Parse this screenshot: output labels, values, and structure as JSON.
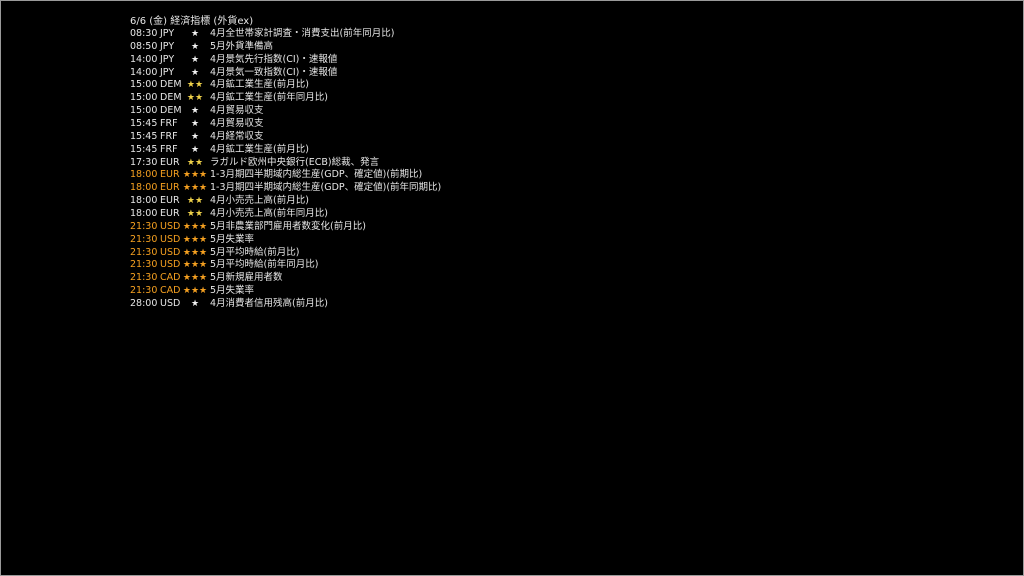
{
  "header": "6/6 (金) 経済指標 (外貨ex)",
  "colors": {
    "background": "#000000",
    "text": "#e6e6e6",
    "highlight": "#f5a020",
    "mid_stars": "#f0d24a"
  },
  "rows": [
    {
      "time": "08:30",
      "currency": "JPY",
      "stars": "★",
      "event": "4月全世帯家計調査・消費支出(前年同月比)",
      "level": 1
    },
    {
      "time": "08:50",
      "currency": "JPY",
      "stars": "★",
      "event": "5月外貨準備高",
      "level": 1
    },
    {
      "time": "14:00",
      "currency": "JPY",
      "stars": "★",
      "event": "4月景気先行指数(CI)・速報値",
      "level": 1
    },
    {
      "time": "14:00",
      "currency": "JPY",
      "stars": "★",
      "event": "4月景気一致指数(CI)・速報値",
      "level": 1
    },
    {
      "time": "15:00",
      "currency": "DEM",
      "stars": "★★",
      "event": "4月鉱工業生産(前月比)",
      "level": 2
    },
    {
      "time": "15:00",
      "currency": "DEM",
      "stars": "★★",
      "event": "4月鉱工業生産(前年同月比)",
      "level": 2
    },
    {
      "time": "15:00",
      "currency": "DEM",
      "stars": "★",
      "event": "4月貿易収支",
      "level": 1
    },
    {
      "time": "15:45",
      "currency": "FRF",
      "stars": "★",
      "event": "4月貿易収支",
      "level": 1
    },
    {
      "time": "15:45",
      "currency": "FRF",
      "stars": "★",
      "event": "4月経常収支",
      "level": 1
    },
    {
      "time": "15:45",
      "currency": "FRF",
      "stars": "★",
      "event": "4月鉱工業生産(前月比)",
      "level": 1
    },
    {
      "time": "17:30",
      "currency": "EUR",
      "stars": "★★",
      "event": "ラガルド欧州中央銀行(ECB)総裁、発言",
      "level": 2
    },
    {
      "time": "18:00",
      "currency": "EUR",
      "stars": "★★★",
      "event": "1-3月期四半期域内総生産(GDP、確定値)(前期比)",
      "level": 3
    },
    {
      "time": "18:00",
      "currency": "EUR",
      "stars": "★★★",
      "event": "1-3月期四半期域内総生産(GDP、確定値)(前年同期比)",
      "level": 3
    },
    {
      "time": "18:00",
      "currency": "EUR",
      "stars": "★★",
      "event": "4月小売売上高(前月比)",
      "level": 2
    },
    {
      "time": "18:00",
      "currency": "EUR",
      "stars": "★★",
      "event": "4月小売売上高(前年同月比)",
      "level": 2
    },
    {
      "time": "21:30",
      "currency": "USD",
      "stars": "★★★",
      "event": "5月非農業部門雇用者数変化(前月比)",
      "level": 3
    },
    {
      "time": "21:30",
      "currency": "USD",
      "stars": "★★★",
      "event": "5月失業率",
      "level": 3
    },
    {
      "time": "21:30",
      "currency": "USD",
      "stars": "★★★",
      "event": "5月平均時給(前月比)",
      "level": 3
    },
    {
      "time": "21:30",
      "currency": "USD",
      "stars": "★★★",
      "event": "5月平均時給(前年同月比)",
      "level": 3
    },
    {
      "time": "21:30",
      "currency": "CAD",
      "stars": "★★★",
      "event": "5月新規雇用者数",
      "level": 3
    },
    {
      "time": "21:30",
      "currency": "CAD",
      "stars": "★★★",
      "event": "5月失業率",
      "level": 3
    },
    {
      "time": "28:00",
      "currency": "USD",
      "stars": "★",
      "event": "4月消費者信用残高(前月比)",
      "level": 1
    }
  ]
}
